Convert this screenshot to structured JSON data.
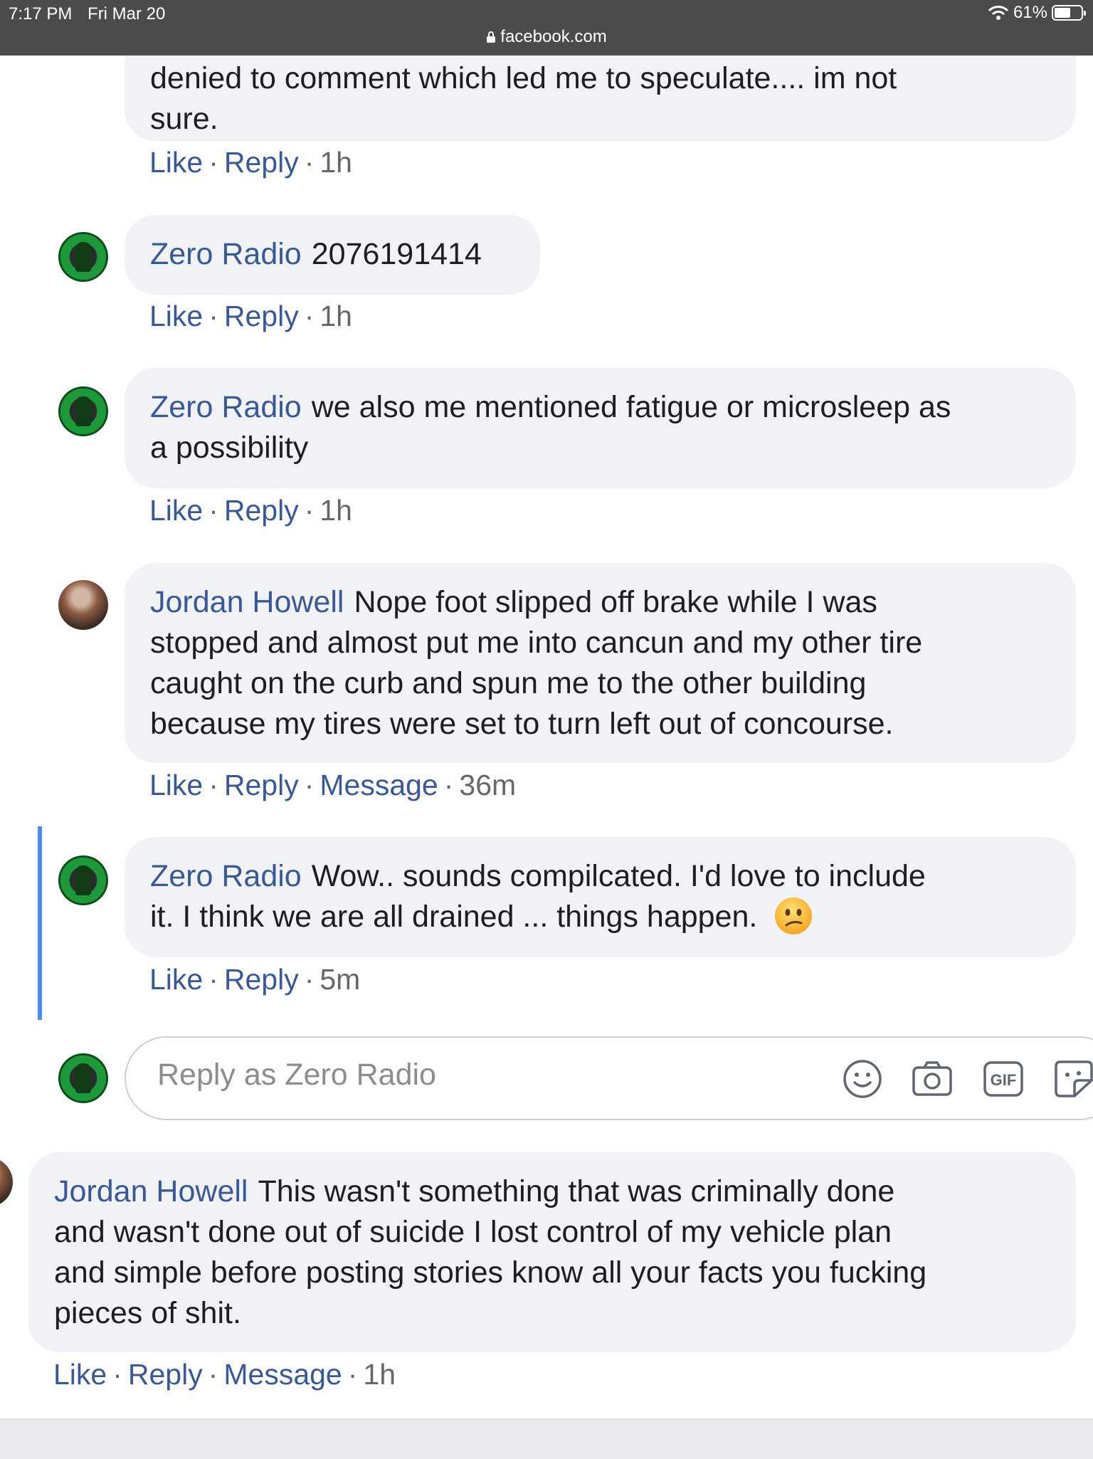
{
  "status_bar": {
    "time": "7:17 PM",
    "date": "Fri Mar 20",
    "battery": "61%",
    "battery_level": 0.61,
    "url": "facebook.com"
  },
  "comments": [
    {
      "text_lines": [
        "denied to comment which led me to speculate.... im not",
        "sure."
      ],
      "actions": {
        "like": "Like",
        "reply": "Reply",
        "time": "1h"
      }
    },
    {
      "author": "Zero Radio",
      "text": "2076191414",
      "actions": {
        "like": "Like",
        "reply": "Reply",
        "time": "1h"
      }
    },
    {
      "author": "Zero Radio",
      "text_lines": [
        "we also me mentioned fatigue or microsleep as",
        "a possibility"
      ],
      "actions": {
        "like": "Like",
        "reply": "Reply",
        "time": "1h"
      }
    },
    {
      "author": "Jordan Howell",
      "text_lines": [
        "Nope foot slipped off brake while I was",
        "stopped and almost put me into cancun and my other tire",
        "caught on the curb and spun me to the other building",
        "because my tires were set to turn left out of concourse."
      ],
      "actions": {
        "like": "Like",
        "reply": "Reply",
        "message": "Message",
        "time": "36m"
      }
    },
    {
      "author": "Zero Radio",
      "text_lines": [
        "Wow.. sounds compilcated. I'd love to include",
        "it. I think we are all drained ... things happen."
      ],
      "actions": {
        "like": "Like",
        "reply": "Reply",
        "time": "5m"
      }
    },
    {
      "author": "Jordan Howell",
      "text_lines": [
        "This wasn't something that was criminally done",
        "and wasn't done out of suicide I lost control of my vehicle plan",
        "and simple before posting stories know all your facts you fucking",
        "pieces of shit."
      ],
      "actions": {
        "like": "Like",
        "reply": "Reply",
        "message": "Message",
        "time": "1h"
      }
    }
  ],
  "reply_box": {
    "placeholder": "Reply as Zero Radio",
    "icons": [
      "smiley-icon",
      "camera-icon",
      "gif-icon",
      "sticker-icon"
    ],
    "gif_label": "GIF"
  },
  "emoji": "confused-face",
  "colors": {
    "link": "#385898",
    "bubble": "#f0f2f5",
    "thread_line": "#4a8cf7"
  }
}
